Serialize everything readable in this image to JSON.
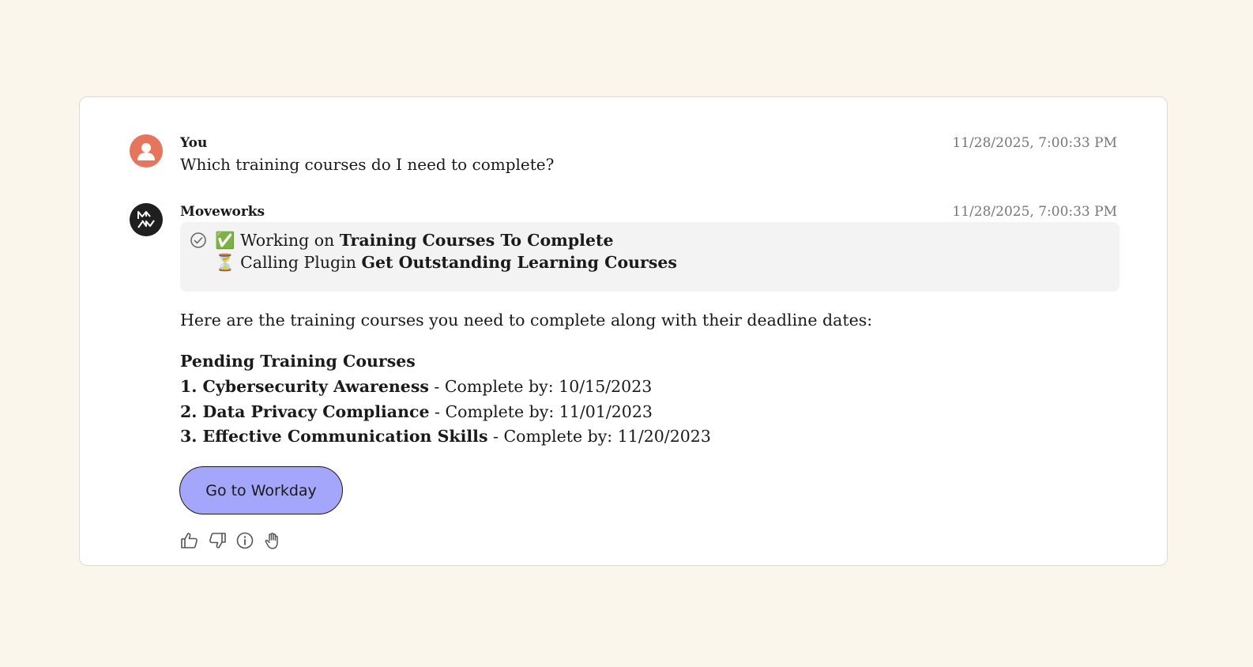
{
  "messages": {
    "user": {
      "sender": "You",
      "timestamp": "11/28/2025, 7:00:33 PM",
      "text": "Which training courses do I need to complete?",
      "avatar_color": "#e7755b"
    },
    "bot": {
      "sender": "Moveworks",
      "timestamp": "11/28/2025, 7:00:33 PM",
      "avatar_color": "#1f1f1f",
      "status": {
        "line1_emoji": "✅",
        "line1_prefix": "Working on",
        "line1_bold": "Training Courses To Complete",
        "line2_emoji": "⏳",
        "line2_prefix": "Calling Plugin",
        "line2_bold": "Get Outstanding Learning Courses"
      },
      "intro": "Here are the training courses you need to complete along with their deadline dates:",
      "list_title": "Pending Training Courses",
      "courses": [
        {
          "name": "1. Cybersecurity Awareness",
          "deadline": " - Complete by: 10/15/2023"
        },
        {
          "name": "2. Data Privacy Compliance",
          "deadline": " - Complete by: 11/01/2023"
        },
        {
          "name": "3. Effective Communication Skills",
          "deadline": " - Complete by: 11/20/2023"
        }
      ],
      "cta_label": "Go to Workday",
      "cta_color": "#a4a6fb"
    }
  },
  "actions": [
    "thumbs-up-icon",
    "thumbs-down-icon",
    "info-icon",
    "hand-icon"
  ]
}
